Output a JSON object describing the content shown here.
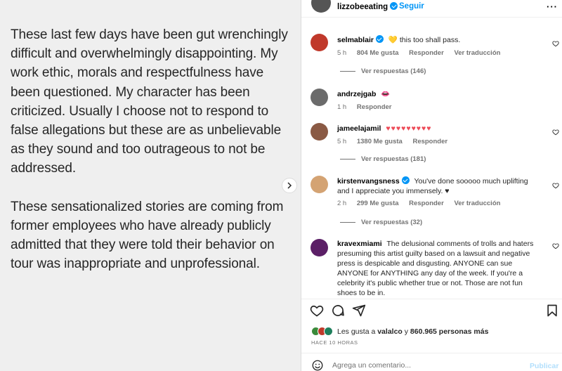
{
  "post": {
    "paragraphs": [
      "These last few days have been gut wrenchingly difficult and overwhelmingly disappointing. My work ethic, morals and respectfulness have been questioned. My character has been criticized. Usually I choose not to respond to false allegations but these are as unbelievable as they sound and too outrageous to not be addressed.",
      "These sensationalized stories are coming from former employees who have already publicly admitted that they were told their behavior on tour was inappropriate and unprofessional."
    ]
  },
  "header": {
    "username": "lizzobeeating",
    "follow_label": "Seguir",
    "more_icon": "more-horizontal-icon"
  },
  "comments": [
    {
      "user": "selmablair",
      "verified": true,
      "text": "💛 this too shall pass.",
      "time": "5 h",
      "likes": "804 Me gusta",
      "reply": "Responder",
      "translate": "Ver traducción",
      "view_replies": "Ver respuestas (146)",
      "avatar_color": "#c0392b"
    },
    {
      "user": "andrzejgab",
      "verified": false,
      "text": "👄",
      "time": "1 h",
      "reply": "Responder",
      "avatar_color": "#6b6b6b"
    },
    {
      "user": "jameelajamil",
      "verified": false,
      "text": "♥♥♥♥♥♥♥♥♥",
      "time": "5 h",
      "likes": "1380 Me gusta",
      "reply": "Responder",
      "view_replies": "Ver respuestas (181)",
      "avatar_color": "#8a5a44"
    },
    {
      "user": "kirstenvangsness",
      "verified": true,
      "text": "You've done sooooo much uplifting and I appreciate you immensely. ♥",
      "time": "2 h",
      "likes": "299 Me gusta",
      "reply": "Responder",
      "translate": "Ver traducción",
      "view_replies": "Ver respuestas (32)",
      "avatar_color": "#d4a373"
    },
    {
      "user": "kravexmiami",
      "verified": false,
      "text": "The delusional comments of trolls and haters presuming this artist guilty based on a lawsuit and negative press is despicable and disgusting. ANYONE can sue ANYONE for ANYTHING any day of the week. If you're a celebrity it's public whether true or not. Those are not fun shoes to be in.",
      "avatar_color": "#5b1f66"
    }
  ],
  "likes_summary": {
    "prefix": "Les gusta a ",
    "user": "valalco",
    "middle": " y ",
    "count": "860.965 personas más"
  },
  "time_ago": "HACE 10 HORAS",
  "compose": {
    "placeholder": "Agrega un comentario...",
    "post_label": "Publicar"
  },
  "colors": {
    "accent": "#0095f6",
    "heart": "#ed4956",
    "muted": "#737373"
  }
}
